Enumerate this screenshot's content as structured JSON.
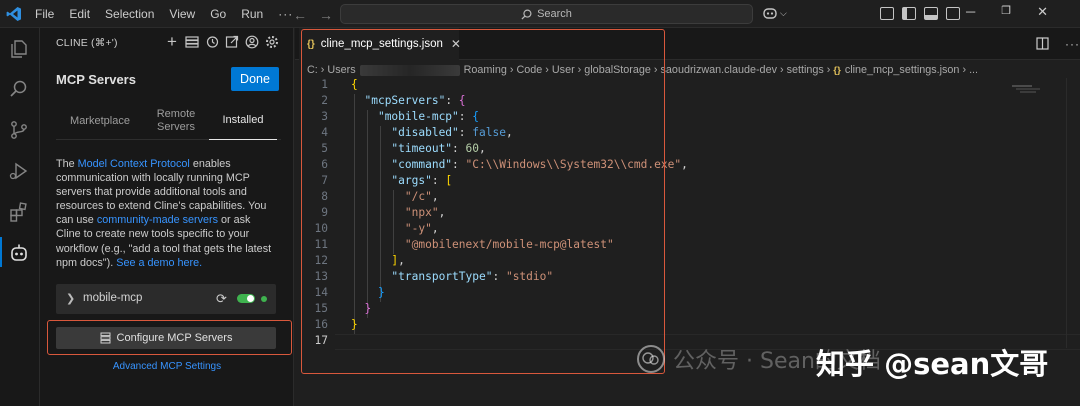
{
  "titlebar": {
    "menu": [
      "File",
      "Edit",
      "Selection",
      "View",
      "Go",
      "Run",
      "···"
    ],
    "search_placeholder": "Search"
  },
  "sidebar": {
    "header": "CLINE (⌘+')",
    "title": "MCP Servers",
    "done_label": "Done",
    "tabs": [
      {
        "label": "Marketplace"
      },
      {
        "label": "Remote Servers"
      },
      {
        "label": "Installed"
      }
    ],
    "description": {
      "t1": "The ",
      "link1": "Model Context Protocol",
      "t2": " enables communication with locally running MCP servers that provide additional tools and resources to extend Cline's capabilities. You can use ",
      "link2": "community-made servers",
      "t3": " or ask Cline to create new tools specific to your workflow (e.g., \"add a tool that gets the latest npm docs\"). ",
      "link3": "See a demo here."
    },
    "server": {
      "name": "mobile-mcp",
      "enabled": true,
      "status_color": "#3fb34f"
    },
    "configure_label": "Configure MCP Servers",
    "advanced_label": "Advanced MCP Settings"
  },
  "editor": {
    "tab_label": "cline_mcp_settings.json",
    "breadcrumb": {
      "c0": "C:",
      "c1": "Users",
      "c2": "Roaming",
      "c3": "Code",
      "c4": "User",
      "c5": "globalStorage",
      "c6": "saoudrizwan.claude-dev",
      "c7": "settings",
      "c8": "cline_mcp_settings.json",
      "c9": "..."
    },
    "lines": {
      "n1": "1",
      "n2": "2",
      "n3": "3",
      "n4": "4",
      "n5": "5",
      "n6": "6",
      "n7": "7",
      "n8": "8",
      "n9": "9",
      "n10": "10",
      "n11": "11",
      "n12": "12",
      "n13": "13",
      "n14": "14",
      "n15": "15",
      "n16": "16",
      "n17": "17"
    },
    "code": {
      "k_mcpServers": "\"mcpServers\"",
      "k_mobile": "\"mobile-mcp\"",
      "k_disabled": "\"disabled\"",
      "v_disabled": "false",
      "k_timeout": "\"timeout\"",
      "v_timeout": "60",
      "k_command": "\"command\"",
      "v_command": "\"C:\\\\Windows\\\\System32\\\\cmd.exe\"",
      "k_args": "\"args\"",
      "a1": "\"/c\"",
      "a2": "\"npx\"",
      "a3": "\"-y\"",
      "a4": "\"@mobilenext/mobile-mcp@latest\"",
      "k_transport": "\"transportType\"",
      "v_transport": "\"stdio\""
    }
  },
  "watermark": {
    "faint": "公众号 · Sean的文档",
    "strong": "知乎 @sean文哥"
  }
}
